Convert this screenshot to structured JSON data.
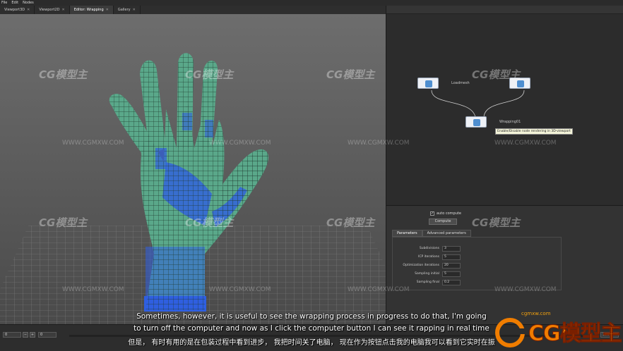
{
  "menu": [
    "File",
    "Edit",
    "Nodes"
  ],
  "tabs": [
    {
      "label": "Viewport3D",
      "active": false,
      "closable": true
    },
    {
      "label": "Viewport2D",
      "active": false,
      "closable": true
    },
    {
      "label": "Editor: Wrapping",
      "active": true,
      "closable": true
    },
    {
      "label": "Gallery",
      "active": false,
      "closable": true
    }
  ],
  "nodegraph": {
    "nodes": [
      {
        "label": "Loadmesh"
      },
      {
        "label": ""
      },
      {
        "label": "Wrapping01"
      }
    ],
    "tooltip": "Enable/Disable node rendering in 3D-viewport"
  },
  "params": {
    "auto_compute_label": "auto compute",
    "auto_compute_checked": true,
    "compute_button": "Compute",
    "tabs": [
      "Parameters",
      "Advanced parameters"
    ],
    "rows": [
      {
        "label": "Subdivisions",
        "value": "3"
      },
      {
        "label": "ICP iterations",
        "value": "5"
      },
      {
        "label": "Optimization iterations",
        "value": "20"
      },
      {
        "label": "Sampling initial",
        "value": "5"
      },
      {
        "label": "Sampling final",
        "value": "0.2"
      }
    ]
  },
  "timeline": {
    "start": "0",
    "current": "0",
    "end": "100"
  },
  "subtitles": {
    "line1": "Sometimes, however, it is useful to see the wrapping process in progress to do that, I'm going",
    "line2": "to turn off the computer and now as I click the computer button I can see it rapping in real time",
    "line3": "但是， 有时有用的是在包装过程中看到进步， 我把时间关了电脑， 现在作为按钮点击我的电脑我可以看到它实时在振"
  },
  "watermarks": {
    "brand": "CG模型主",
    "url": "WWW.CGMXW.COM",
    "logo_url": "cgmxw.com",
    "logo_text": "CG模型主"
  }
}
